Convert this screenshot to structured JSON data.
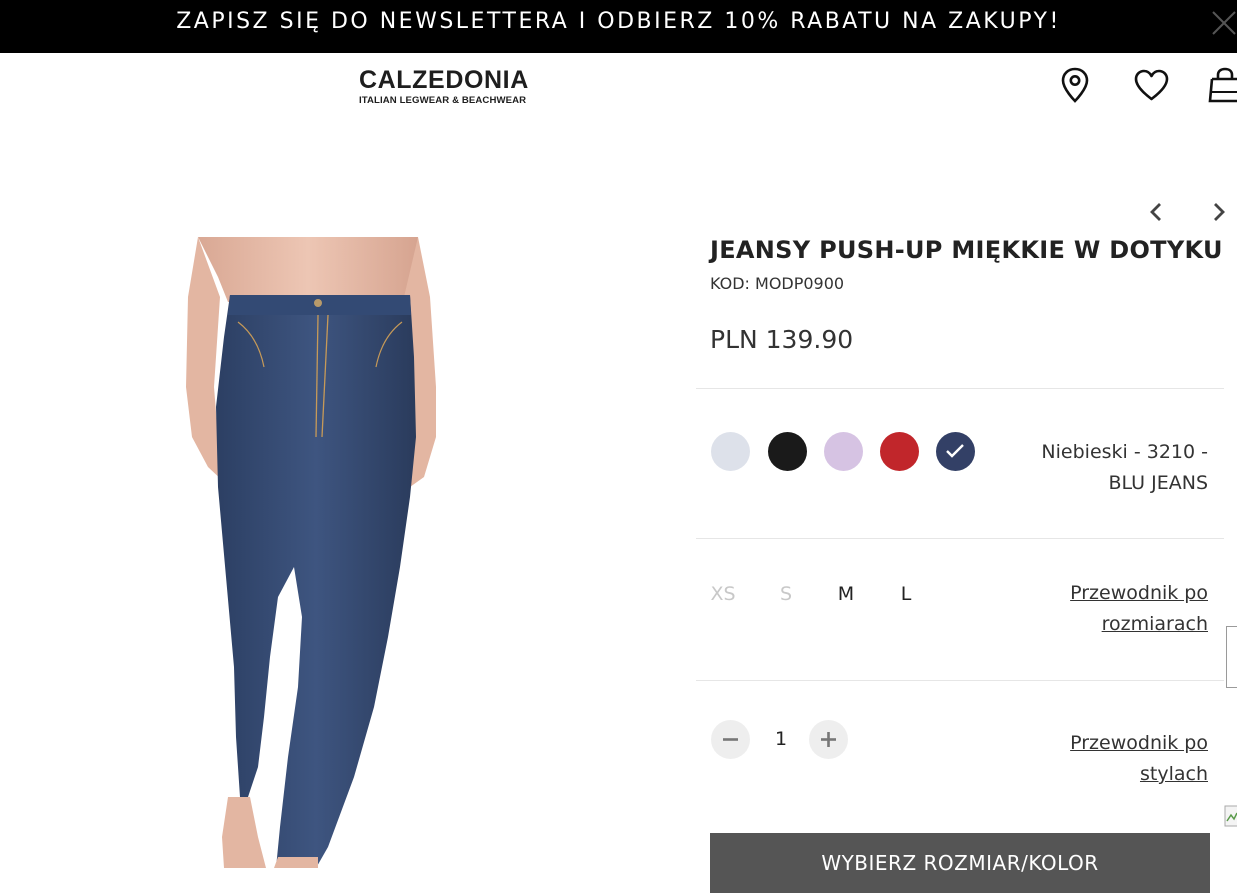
{
  "promo": {
    "text": "ZAPISZ SIĘ DO NEWSLETTERA I ODBIERZ 10% RABATU NA ZAKUPY!"
  },
  "brand": {
    "name": "CALZEDONIA",
    "tagline": "ITALIAN LEGWEAR & BEACHWEAR"
  },
  "header_icons": [
    "location-pin-icon",
    "heart-icon",
    "shopping-bag-icon"
  ],
  "product": {
    "title": "JEANSY PUSH-UP MIĘKKIE W DOTYKU",
    "code": "KOD: MODP0900",
    "price": "PLN 139.90",
    "image_alt": "blue skinny jeans"
  },
  "colors": {
    "swatches": [
      {
        "name": "light-grey",
        "hex": "#dde1ea"
      },
      {
        "name": "black",
        "hex": "#1a1a1a"
      },
      {
        "name": "lilac",
        "hex": "#d6c3e3"
      },
      {
        "name": "red",
        "hex": "#c1262b"
      },
      {
        "name": "navy",
        "hex": "#334066",
        "selected": true
      }
    ],
    "selected_label_1": "Niebieski - 3210 -",
    "selected_label_2": "BLU JEANS"
  },
  "sizes": [
    {
      "label": "XS",
      "available": false
    },
    {
      "label": "S",
      "available": false
    },
    {
      "label": "M",
      "available": true
    },
    {
      "label": "L",
      "available": true
    }
  ],
  "size_guide": {
    "line1": "Przewodnik po",
    "line2": "rozmiarach"
  },
  "quantity": {
    "value": "1"
  },
  "style_guide": {
    "line1": "Przewodnik po",
    "line2": "stylach"
  },
  "cta": {
    "label": "WYBIERZ ROZMIAR/KOLOR"
  }
}
